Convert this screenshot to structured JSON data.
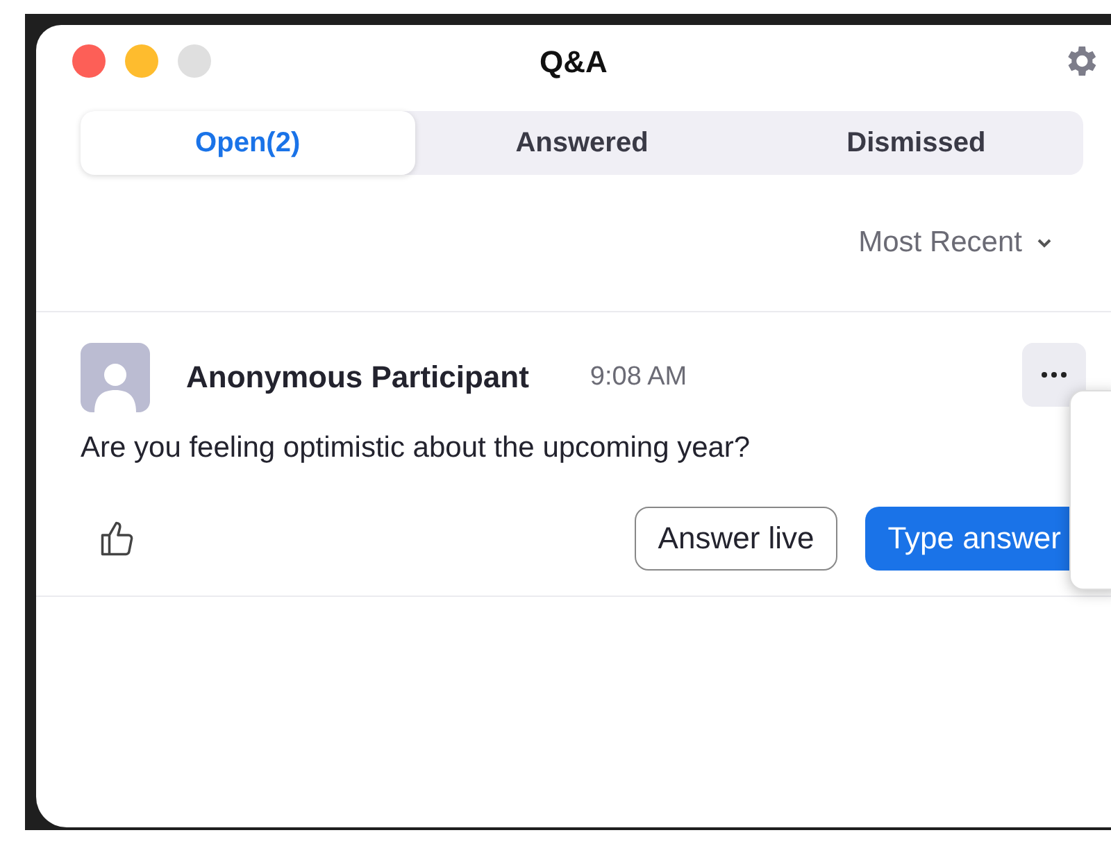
{
  "window": {
    "title": "Q&A"
  },
  "tabs": [
    {
      "label": "Open(2)",
      "selected": true
    },
    {
      "label": "Answered",
      "selected": false
    },
    {
      "label": "Dismissed",
      "selected": false
    }
  ],
  "sort": {
    "label": "Most Recent"
  },
  "questions": [
    {
      "author": "Anonymous Participant",
      "time": "9:08 AM",
      "text": "Are you feeling optimistic about the upcoming year?",
      "actions": [
        {
          "label": "Answer live",
          "kind": "secondary"
        },
        {
          "label": "Type answer",
          "kind": "primary"
        }
      ]
    }
  ]
}
